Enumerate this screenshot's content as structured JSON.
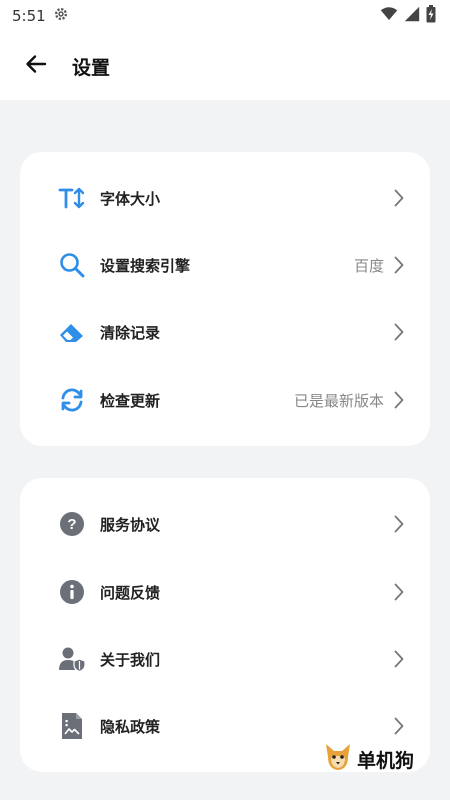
{
  "status_bar": {
    "time": "5:51"
  },
  "header": {
    "title": "设置"
  },
  "colors": {
    "accent": "#2f8fe8",
    "icon_gray": "#6b6f78",
    "chevron": "#777777"
  },
  "section1": {
    "items": [
      {
        "label": "字体大小",
        "value": "",
        "icon": "text-size-icon"
      },
      {
        "label": "设置搜索引擎",
        "value": "百度",
        "icon": "search-icon"
      },
      {
        "label": "清除记录",
        "value": "",
        "icon": "eraser-icon"
      },
      {
        "label": "检查更新",
        "value": "已是最新版本",
        "icon": "refresh-icon"
      }
    ]
  },
  "section2": {
    "items": [
      {
        "label": "服务协议",
        "icon": "help-circle-icon"
      },
      {
        "label": "问题反馈",
        "icon": "info-circle-icon"
      },
      {
        "label": "关于我们",
        "icon": "user-shield-icon"
      },
      {
        "label": "隐私政策",
        "icon": "document-icon"
      }
    ]
  },
  "watermark": {
    "text": "单机狗"
  }
}
